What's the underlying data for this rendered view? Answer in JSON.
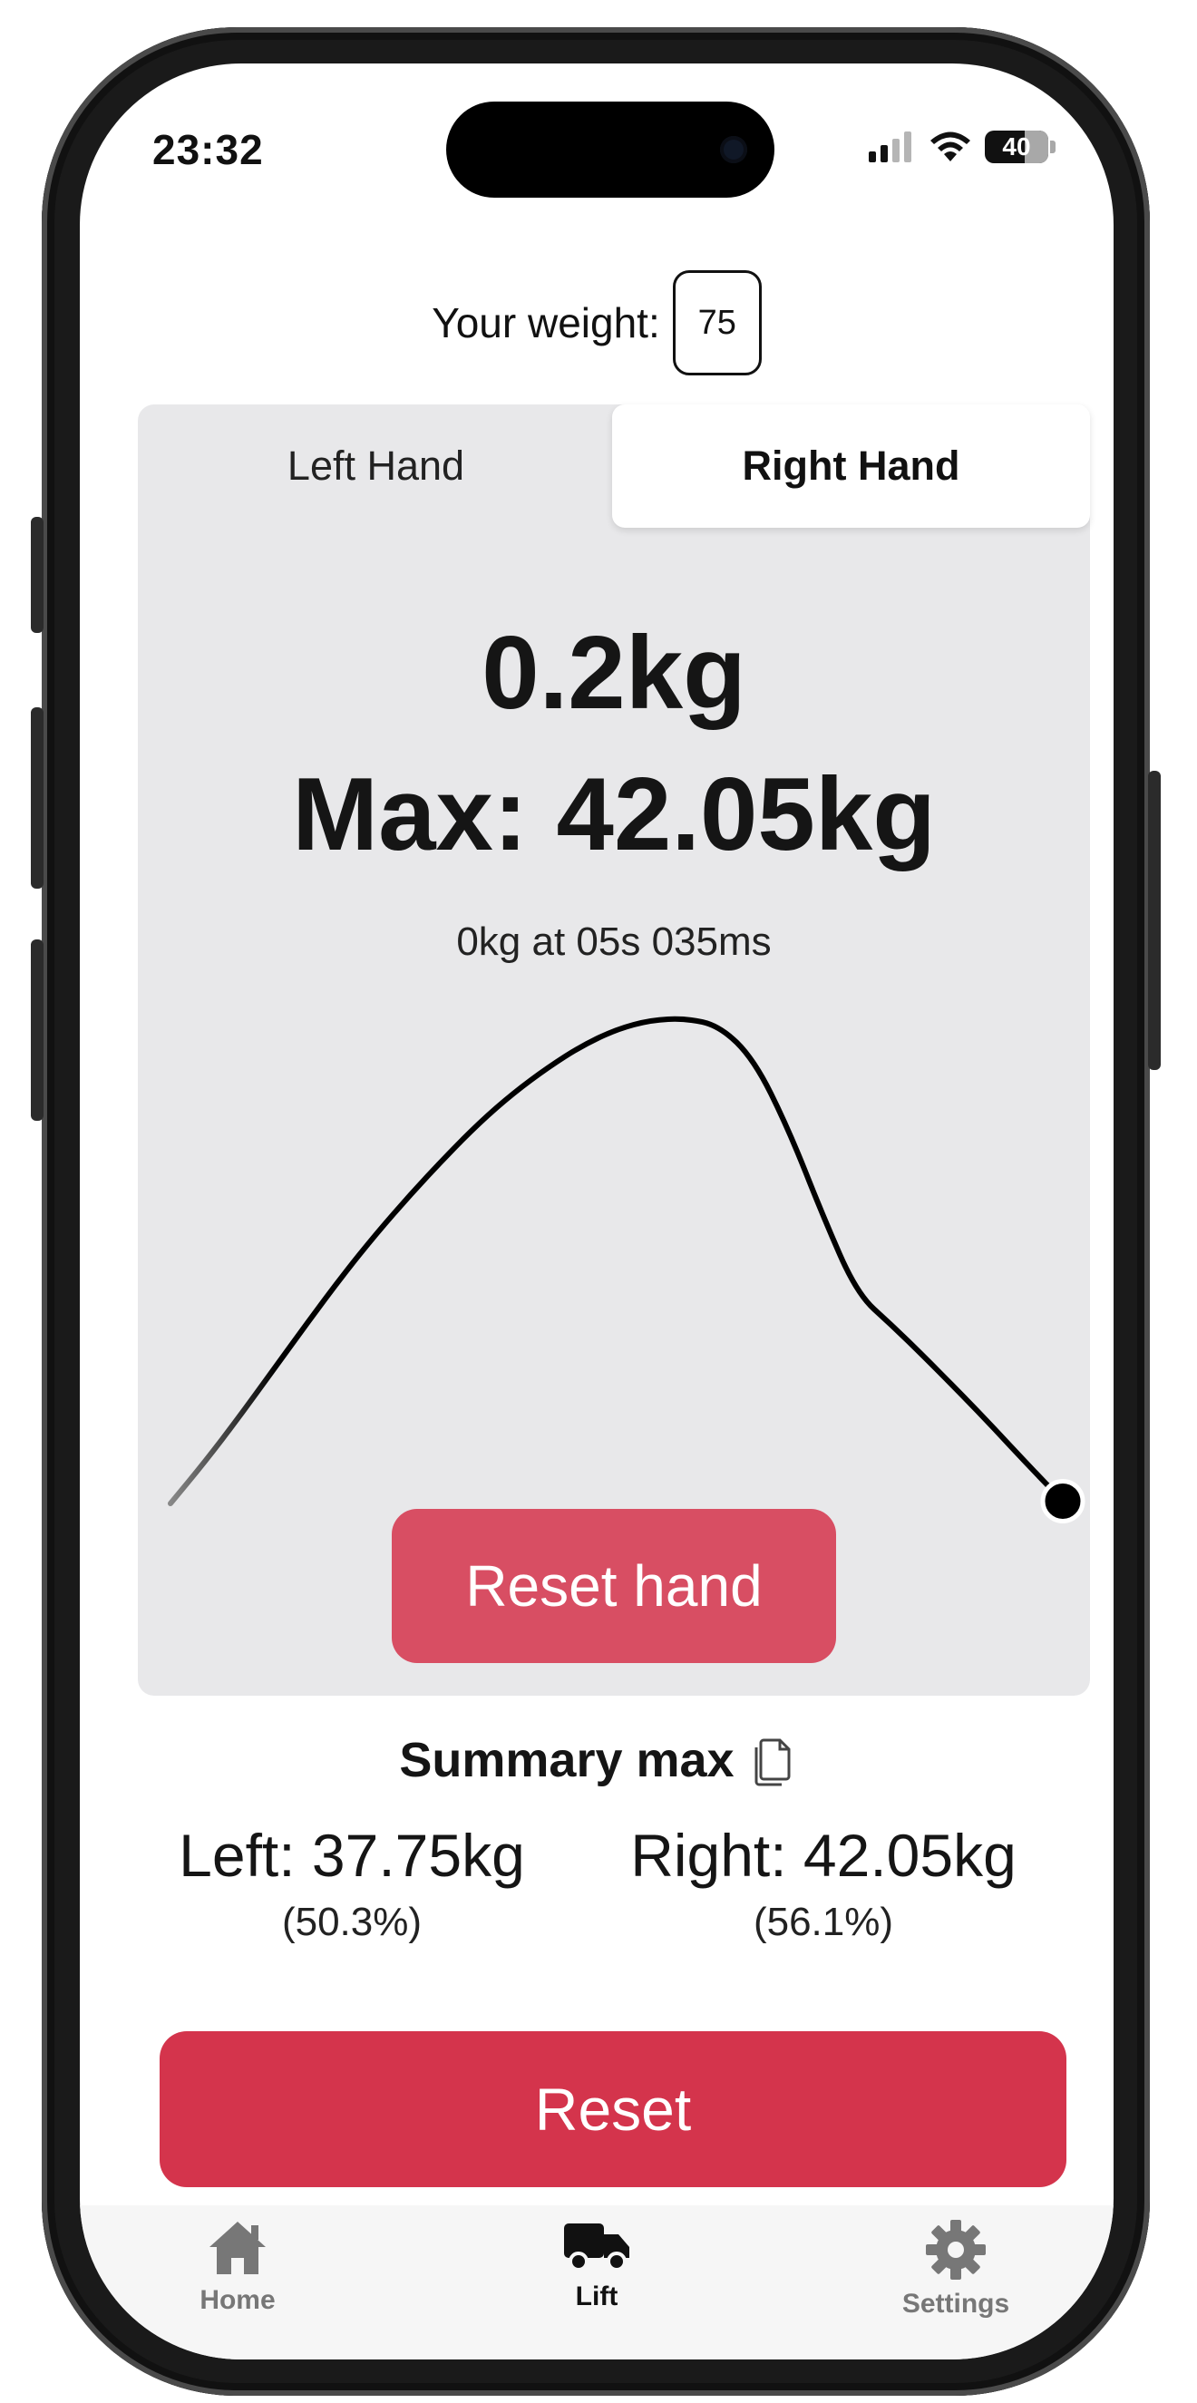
{
  "status_bar": {
    "time": "23:32",
    "battery": "40"
  },
  "weight": {
    "label": "Your weight:",
    "value": "75"
  },
  "tabs": {
    "left": "Left Hand",
    "right": "Right Hand",
    "selected": "right"
  },
  "readout": {
    "current": "0.2kg",
    "max": "Max: 42.05kg",
    "cursor": "0kg at 05s 035ms"
  },
  "chart_data": {
    "type": "line",
    "series": [
      {
        "values": [
          0,
          3.6,
          7.5,
          11.6,
          15.7,
          19.7,
          23.4,
          26.8,
          30.0,
          33.0,
          35.6,
          37.8,
          39.7,
          41.1,
          41.9,
          42.05,
          41.4,
          38.5,
          32.5,
          25.0,
          18.2,
          15.5,
          12.6,
          9.6,
          6.5,
          3.3,
          0.2
        ]
      }
    ],
    "marker_last_point": true,
    "grid": false
  },
  "buttons": {
    "reset_hand": "Reset hand",
    "reset": "Reset"
  },
  "summary": {
    "title": "Summary max",
    "left_value": "Left: 37.75kg",
    "left_pct": "(50.3%)",
    "right_value": "Right: 42.05kg",
    "right_pct": "(56.1%)"
  },
  "tabbar": {
    "items": [
      {
        "label": "Home",
        "icon": "house-icon"
      },
      {
        "label": "Lift",
        "icon": "truck-icon"
      },
      {
        "label": "Settings",
        "icon": "gear-icon"
      }
    ],
    "active": "Lift"
  },
  "colors": {
    "reset_hand_bg": "#d84e63",
    "reset_bg": "#d4344c",
    "panel_bg": "#e8e8ea"
  }
}
